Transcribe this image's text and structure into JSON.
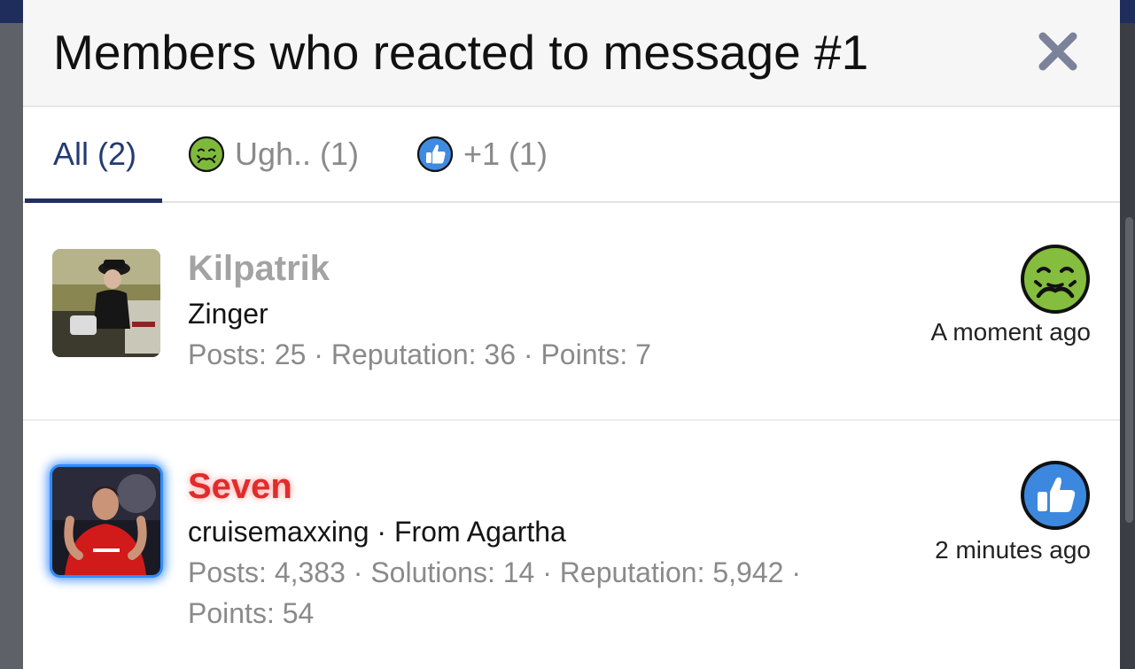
{
  "modal": {
    "title": "Members who reacted to message #1",
    "close_icon": "close-icon"
  },
  "tabs": [
    {
      "label": "All",
      "count": "(2)",
      "active": true
    },
    {
      "label": "Ugh..",
      "count": "(1)",
      "icon": "nauseated-face-icon"
    },
    {
      "label": "+1",
      "count": "(1)",
      "icon": "thumbs-up-icon"
    }
  ],
  "members": [
    {
      "name": "Kilpatrik",
      "title": "Zinger",
      "stats": "Posts: 25 · Reputation: 36 · Points: 7",
      "reaction_icon": "nauseated-face-icon",
      "time": "A moment ago"
    },
    {
      "name": "Seven",
      "title": "cruisemaxxing · From Agartha",
      "stats_line1": "Posts: 4,383 · Solutions: 14 · Reputation: 5,942 ·",
      "stats_line2": "Points: 54",
      "reaction_icon": "thumbs-up-icon",
      "time": "2 minutes ago"
    }
  ],
  "colors": {
    "active_tab": "#233a73",
    "name_primary": "#a3a3a3",
    "name_highlight": "#e02c2c",
    "avatar_glow": "#2f8cff"
  }
}
